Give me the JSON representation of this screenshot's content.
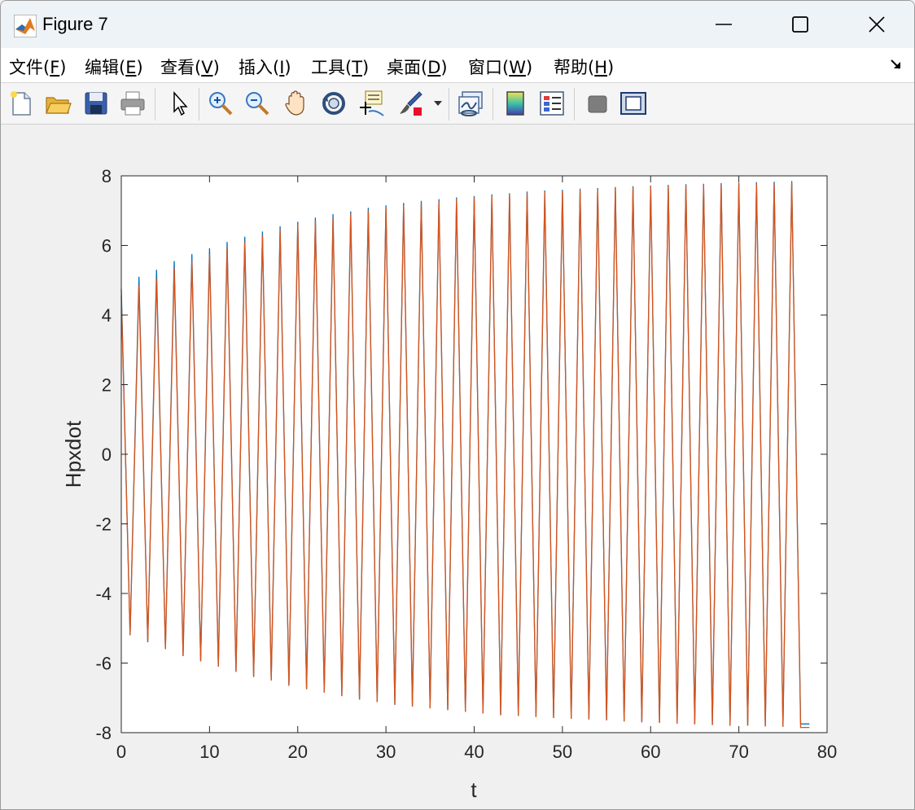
{
  "window": {
    "title": "Figure 7",
    "controls": [
      "minimize",
      "maximize",
      "close"
    ]
  },
  "menu": [
    {
      "text": "文件(",
      "key": "F",
      "tail": ")"
    },
    {
      "text": "编辑(",
      "key": "E",
      "tail": ")"
    },
    {
      "text": "查看(",
      "key": "V",
      "tail": ")"
    },
    {
      "text": "插入(",
      "key": "I",
      "tail": ")"
    },
    {
      "text": "工具(",
      "key": "T",
      "tail": ")"
    },
    {
      "text": "桌面(",
      "key": "D",
      "tail": ")"
    },
    {
      "text": "窗口(",
      "key": "W",
      "tail": ")"
    },
    {
      "text": "帮助(",
      "key": "H",
      "tail": ")"
    }
  ],
  "toolbar": {
    "icons": [
      "new-figure-icon",
      "open-file-icon",
      "save-icon",
      "print-icon",
      "edit-plot-icon",
      "zoom-in-icon",
      "zoom-out-icon",
      "pan-icon",
      "rotate-3d-icon",
      "data-cursor-icon",
      "brush-icon",
      "brush-dropdown-icon",
      "link-plot-icon",
      "colorbar-icon",
      "legend-icon",
      "hide-plot-tools-icon",
      "show-plot-tools-icon"
    ]
  },
  "colors": {
    "series1": "#0072BD",
    "series2": "#D95319"
  },
  "chart_data": {
    "type": "line",
    "title": "",
    "xlabel": "t",
    "ylabel": "Hpxdot",
    "xlim": [
      0,
      80
    ],
    "ylim": [
      -8,
      8
    ],
    "xticks": [
      "0",
      "10",
      "20",
      "30",
      "40",
      "50",
      "60",
      "70",
      "80"
    ],
    "yticks": [
      "-8",
      "-6",
      "-4",
      "-2",
      "0",
      "2",
      "4",
      "6",
      "8"
    ],
    "grid": false,
    "legend": "none",
    "series": [
      {
        "x": [
          0,
          1,
          2,
          3,
          4,
          5,
          6,
          7,
          8,
          9,
          10,
          11,
          12,
          13,
          14,
          15,
          16,
          17,
          18,
          19,
          20,
          21,
          22,
          23,
          24,
          25,
          26,
          27,
          28,
          29,
          30,
          31,
          32,
          33,
          34,
          35,
          36,
          37,
          38,
          39,
          40,
          41,
          42,
          43,
          44,
          45,
          46,
          47,
          48,
          49,
          50,
          51,
          52,
          53,
          54,
          55,
          56,
          57,
          58,
          59,
          60,
          61,
          62,
          63,
          64,
          65,
          66,
          67,
          68,
          69,
          70,
          71,
          72,
          73,
          74,
          75,
          76,
          77,
          78
        ],
        "y": [
          4.75,
          -5.2,
          5.1,
          -5.4,
          5.3,
          -5.6,
          5.55,
          -5.8,
          5.75,
          -5.95,
          5.92,
          -6.1,
          6.1,
          -6.25,
          6.25,
          -6.4,
          6.4,
          -6.5,
          6.55,
          -6.65,
          6.68,
          -6.75,
          6.8,
          -6.85,
          6.9,
          -6.95,
          6.98,
          -7.05,
          7.08,
          -7.12,
          7.15,
          -7.2,
          7.22,
          -7.25,
          7.28,
          -7.3,
          7.33,
          -7.35,
          7.38,
          -7.4,
          7.42,
          -7.45,
          7.47,
          -7.5,
          7.5,
          -7.52,
          7.55,
          -7.55,
          7.58,
          -7.58,
          7.6,
          -7.6,
          7.63,
          -7.62,
          7.65,
          -7.65,
          7.68,
          -7.68,
          7.7,
          -7.7,
          7.72,
          -7.72,
          7.74,
          -7.74,
          7.76,
          -7.76,
          7.77,
          -7.78,
          7.79,
          -7.8,
          7.8,
          -7.8,
          7.82,
          -7.82,
          7.83,
          -7.83,
          7.85,
          -7.75,
          -7.75
        ]
      },
      {
        "x": [
          0,
          1,
          2,
          3,
          4,
          5,
          6,
          7,
          8,
          9,
          10,
          11,
          12,
          13,
          14,
          15,
          16,
          17,
          18,
          19,
          20,
          21,
          22,
          23,
          24,
          25,
          26,
          27,
          28,
          29,
          30,
          31,
          32,
          33,
          34,
          35,
          36,
          37,
          38,
          39,
          40,
          41,
          42,
          43,
          44,
          45,
          46,
          47,
          48,
          49,
          50,
          51,
          52,
          53,
          54,
          55,
          56,
          57,
          58,
          59,
          60,
          61,
          62,
          63,
          64,
          65,
          66,
          67,
          68,
          69,
          70,
          71,
          72,
          73,
          74,
          75,
          76,
          77,
          78
        ],
        "y": [
          4.55,
          -5.2,
          4.85,
          -5.4,
          5.05,
          -5.6,
          5.35,
          -5.8,
          5.55,
          -5.95,
          5.75,
          -6.1,
          5.95,
          -6.25,
          6.1,
          -6.4,
          6.3,
          -6.5,
          6.45,
          -6.65,
          6.6,
          -6.75,
          6.7,
          -6.85,
          6.8,
          -6.95,
          6.9,
          -7.05,
          7.0,
          -7.12,
          7.08,
          -7.2,
          7.15,
          -7.25,
          7.22,
          -7.3,
          7.28,
          -7.35,
          7.33,
          -7.4,
          7.38,
          -7.45,
          7.42,
          -7.5,
          7.47,
          -7.52,
          7.5,
          -7.55,
          7.53,
          -7.58,
          7.56,
          -7.6,
          7.6,
          -7.62,
          7.62,
          -7.65,
          7.65,
          -7.68,
          7.67,
          -7.7,
          7.7,
          -7.72,
          7.71,
          -7.74,
          7.73,
          -7.76,
          7.74,
          -7.78,
          7.75,
          -7.8,
          7.77,
          -7.8,
          7.78,
          -7.82,
          7.78,
          -7.83,
          7.8,
          -7.85,
          -7.85
        ]
      }
    ]
  }
}
